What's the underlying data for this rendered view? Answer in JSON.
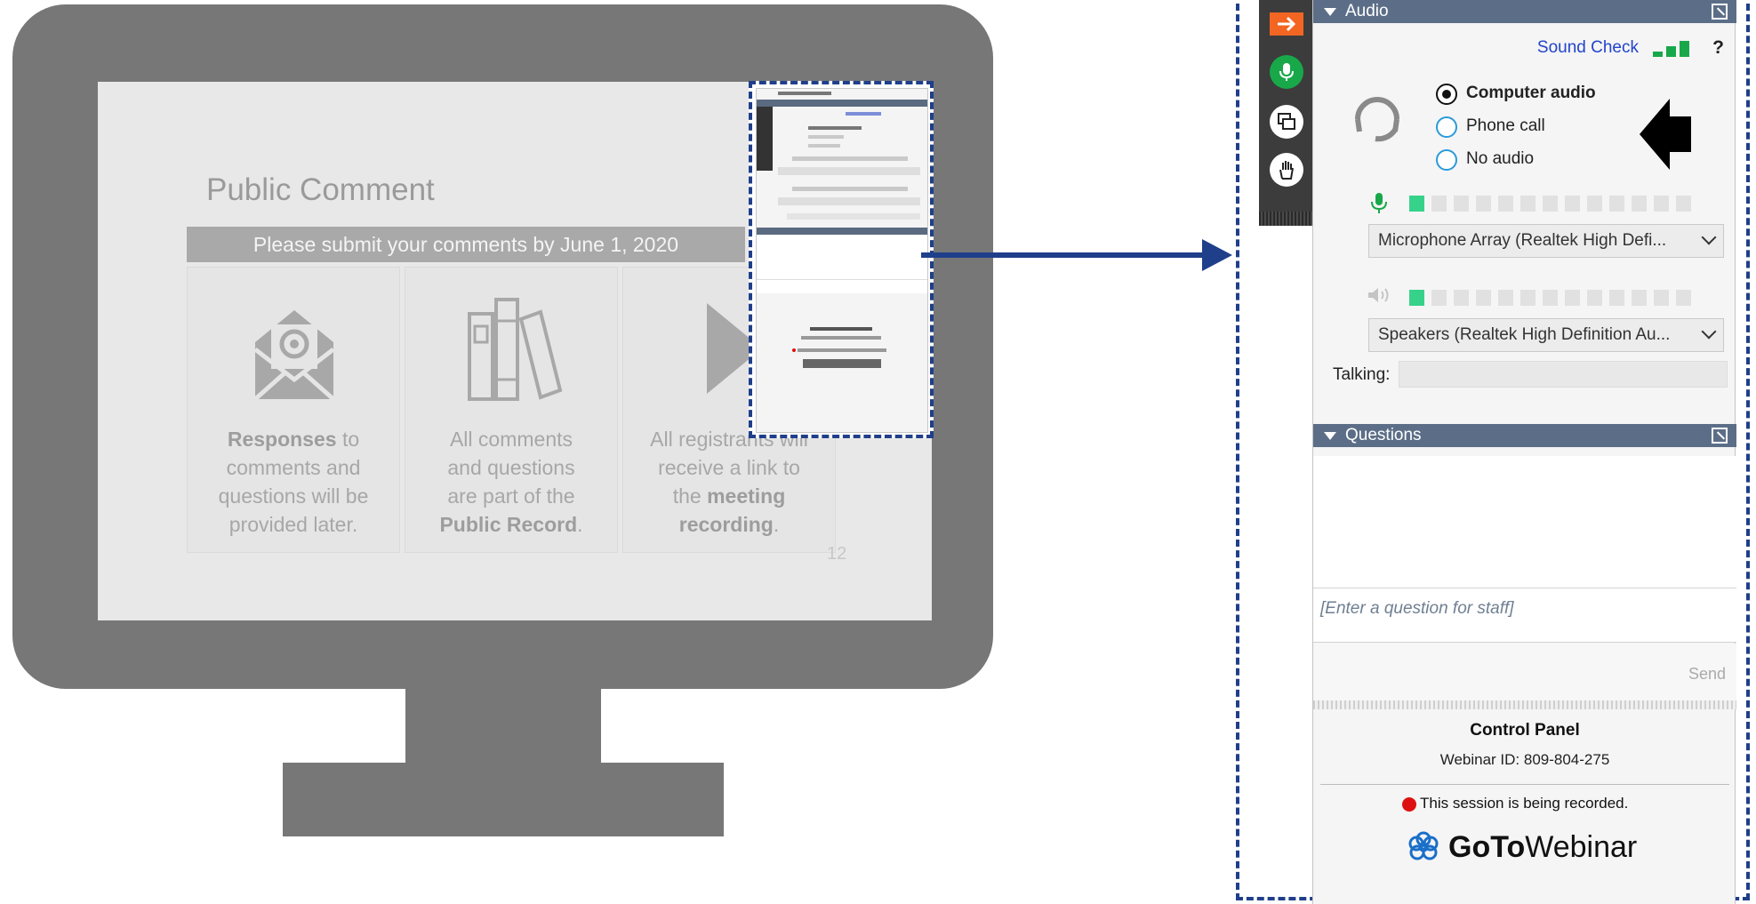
{
  "slide": {
    "title": "Public Comment",
    "banner": "Please submit your comments by June 1, 2020",
    "page_number": "12",
    "cards": [
      {
        "lines": [
          {
            "b": "Responses",
            "t": " to"
          },
          {
            "t": "comments and"
          },
          {
            "t": "questions will be"
          },
          {
            "t": "provided later."
          }
        ]
      },
      {
        "lines": [
          {
            "t": "All comments"
          },
          {
            "t": "and questions"
          },
          {
            "t": "are part of the"
          },
          {
            "b": "Public Record",
            "t": "."
          }
        ]
      },
      {
        "lines": [
          {
            "t": "All registrants will"
          },
          {
            "t": "receive a link to"
          },
          {
            "pre": "the ",
            "b": "meeting"
          },
          {
            "b": "recording",
            "t": "."
          }
        ]
      }
    ]
  },
  "panel": {
    "audio_header": "Audio",
    "sound_check": "Sound Check",
    "help": "?",
    "audio_options": [
      "Computer audio",
      "Phone call",
      "No audio"
    ],
    "selected_audio": "Computer audio",
    "microphone": "Microphone Array (Realtek High Defi...",
    "speakers": "Speakers (Realtek High Definition Au...",
    "talking_label": "Talking:",
    "questions_header": "Questions",
    "question_placeholder": "[Enter a question for staff]",
    "send": "Send",
    "footer_title": "Control Panel",
    "webinar_id": "Webinar ID: 809-804-275",
    "recording_notice": "This session is being recorded.",
    "brand_bold": "GoTo",
    "brand_light": "Webinar"
  },
  "icons": {
    "sidebar": [
      "arrow-right-icon",
      "microphone-icon",
      "screen-share-icon",
      "raise-hand-icon"
    ],
    "pointer": "pointing-arrow-icon"
  },
  "colors": {
    "accent_orange": "#f26522",
    "header_bar": "#5c6e87",
    "sound_check_link": "#2244cc",
    "meter_green": "#36d28a",
    "dashed_border": "#1f3f8a",
    "recording_red": "#dd1111",
    "monitor_gray": "#777777"
  }
}
